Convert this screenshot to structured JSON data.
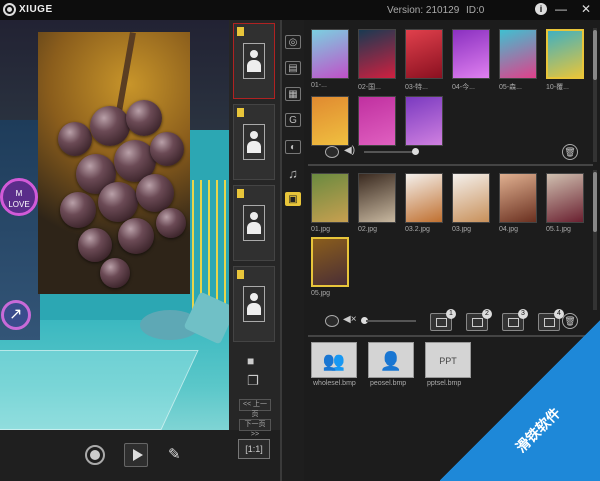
{
  "titlebar": {
    "app_name": "XIUGE",
    "version": "Version: 210129",
    "device_id": "ID:0",
    "info_glyph": "i",
    "minimize_glyph": "—",
    "close_glyph": "✕"
  },
  "preview": {
    "neon_text": "M\nLOVE"
  },
  "side": {
    "prev_page": "<< 上一页",
    "next_page": "下一页 >>",
    "ratio": "[1:1]",
    "camera_glyph": "■",
    "copy_glyph": "❐"
  },
  "categories": [
    "photo",
    "film",
    "template",
    "gif",
    "palette",
    "music",
    "frame"
  ],
  "templates": {
    "items": [
      {
        "label": "01-...",
        "colors": [
          "#7bd0e0",
          "#c050c8"
        ]
      },
      {
        "label": "02-国...",
        "colors": [
          "#1a3a52",
          "#d02040"
        ]
      },
      {
        "label": "03-特...",
        "colors": [
          "#e0404c",
          "#8a1020"
        ]
      },
      {
        "label": "04-今...",
        "colors": [
          "#8a30c0",
          "#e080f0"
        ]
      },
      {
        "label": "05-森...",
        "colors": [
          "#40c0d0",
          "#e0408a"
        ]
      },
      {
        "label": "10-覆...",
        "colors": [
          "#40b0c0",
          "#e8c53a"
        ]
      },
      {
        "label": "",
        "colors": [
          "#e08a30",
          "#f0c040"
        ]
      },
      {
        "label": "",
        "colors": [
          "#c030a0",
          "#e060c0"
        ]
      },
      {
        "label": "",
        "colors": [
          "#7a3ac0",
          "#d080e0"
        ]
      }
    ]
  },
  "photos": {
    "items": [
      {
        "label": "01.jpg",
        "colors": [
          "#6a8a40",
          "#c8a050"
        ]
      },
      {
        "label": "02.jpg",
        "colors": [
          "#3a2a20",
          "#c8b8a0"
        ]
      },
      {
        "label": "03.2.jpg",
        "colors": [
          "#f4f0ec",
          "#c07030"
        ]
      },
      {
        "label": "03.jpg",
        "colors": [
          "#f4f0ec",
          "#c8905a"
        ]
      },
      {
        "label": "04.jpg",
        "colors": [
          "#e0b090",
          "#6a3020"
        ]
      },
      {
        "label": "05.1.jpg",
        "colors": [
          "#d0c0b0",
          "#6a2030"
        ]
      },
      {
        "label": "05.jpg",
        "colors": [
          "#8a5d1c",
          "#4a2e35"
        ]
      }
    ]
  },
  "number_buttons": [
    "1",
    "2",
    "3",
    "4"
  ],
  "files": [
    {
      "label": "wholesel.bmp"
    },
    {
      "label": "peosel.bmp"
    },
    {
      "label": "pptsel.bmp"
    }
  ],
  "watermark": "滑铁软件",
  "accent": "#e8c53a"
}
